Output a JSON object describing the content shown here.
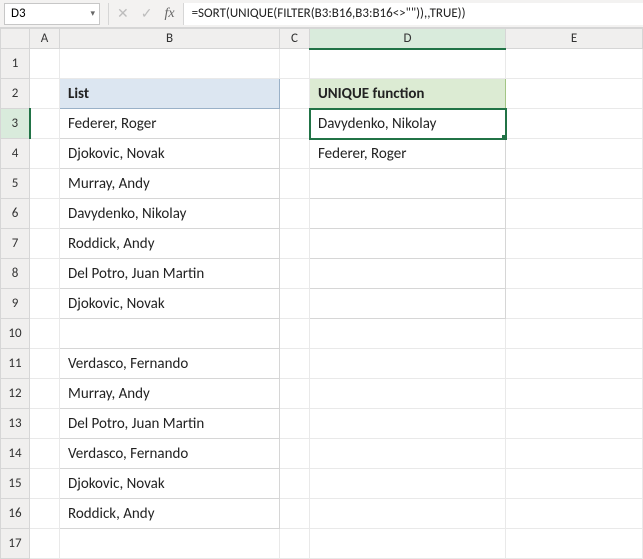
{
  "formula_bar": {
    "namebox": "D3",
    "formula": "=SORT(UNIQUE(FILTER(B3:B16,B3:B16<>\"\")),,TRUE))"
  },
  "icons": {
    "cancel": "✕",
    "confirm": "✓",
    "fx": "fx",
    "dropdown": "▾"
  },
  "columns": [
    "A",
    "B",
    "C",
    "D",
    "E"
  ],
  "rows": [
    "1",
    "2",
    "3",
    "4",
    "5",
    "6",
    "7",
    "8",
    "9",
    "10",
    "11",
    "12",
    "13",
    "14",
    "15",
    "16",
    "17"
  ],
  "list_header": "List",
  "list_items": [
    "Federer, Roger",
    "Djokovic, Novak",
    "Murray, Andy",
    "Davydenko, Nikolay",
    "Roddick, Andy",
    "Del Potro, Juan Martin",
    "Djokovic, Novak",
    "",
    "Verdasco, Fernando",
    "Murray, Andy",
    "Del Potro, Juan Martin",
    "Verdasco, Fernando",
    "Djokovic, Novak",
    "Roddick, Andy"
  ],
  "unique_header": "UNIQUE function",
  "unique_items": [
    "Davydenko, Nikolay",
    "Federer, Roger",
    "",
    "",
    "",
    "",
    ""
  ]
}
